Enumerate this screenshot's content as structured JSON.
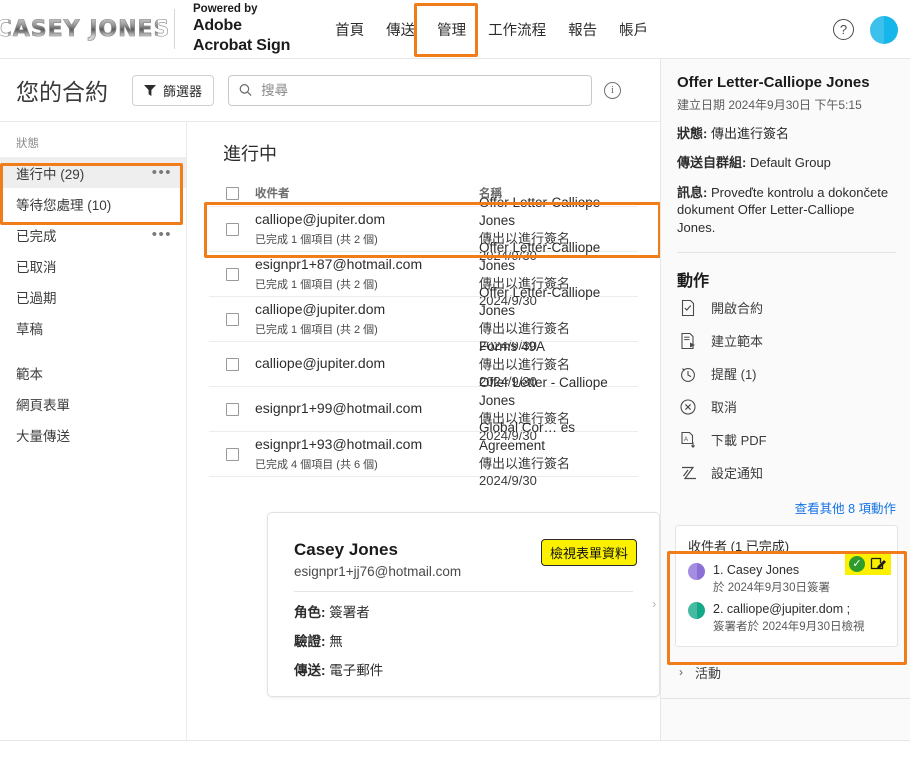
{
  "topbar": {
    "logo_text": "CASEY JONES",
    "powered_line1": "Powered by",
    "powered_line2": "Adobe",
    "powered_line3": "Acrobat Sign",
    "nav": [
      {
        "label": "首頁",
        "name": "nav-home"
      },
      {
        "label": "傳送",
        "name": "nav-send"
      },
      {
        "label": "管理",
        "name": "nav-manage"
      },
      {
        "label": "工作流程",
        "name": "nav-workflow"
      },
      {
        "label": "報告",
        "name": "nav-reports"
      },
      {
        "label": "帳戶",
        "name": "nav-account"
      }
    ],
    "help_glyph": "?",
    "highlight_color": "#f07d1a"
  },
  "titlebar": {
    "page_title": "您的合約",
    "filter_label": "篩選器",
    "search_placeholder": "搜尋",
    "search_value": "",
    "info_glyph": "i"
  },
  "sidebar": {
    "section_label": "狀態",
    "items": [
      {
        "label": "進行中 (29)",
        "name": "sidebar-item-in-progress",
        "selected": true,
        "dots": true
      },
      {
        "label": "等待您處理 (10)",
        "name": "sidebar-item-waiting-for-you",
        "selected": false,
        "dots": false
      },
      {
        "label": "已完成",
        "name": "sidebar-item-completed",
        "selected": false,
        "dots": true
      },
      {
        "label": "已取消",
        "name": "sidebar-item-cancelled",
        "selected": false,
        "dots": false
      },
      {
        "label": "已過期",
        "name": "sidebar-item-expired",
        "selected": false,
        "dots": false
      },
      {
        "label": "草稿",
        "name": "sidebar-item-draft",
        "selected": false,
        "dots": false
      }
    ],
    "items2": [
      {
        "label": "範本",
        "name": "sidebar-item-templates"
      },
      {
        "label": "網頁表單",
        "name": "sidebar-item-web-forms"
      },
      {
        "label": "大量傳送",
        "name": "sidebar-item-bulk-send"
      }
    ],
    "dots_glyph": "•••"
  },
  "main": {
    "heading": "進行中",
    "columns": {
      "recipient": "收件者",
      "name": "名稱"
    },
    "rows": [
      {
        "recipient": "calliope@jupiter.dom",
        "recipient_sub": "已完成 1 個項目 (共 2 個)",
        "name": "Offer Letter-Calliope Jones",
        "status": "傳出以進行簽名",
        "date": "2024/9/30",
        "highlighted": true
      },
      {
        "recipient": "esignpr1+87@hotmail.com",
        "recipient_sub": "已完成 1 個項目 (共 2 個)",
        "name": "Offer Letter-Calliope Jones",
        "status": "傳出以進行簽名",
        "date": "2024/9/30",
        "highlighted": false
      },
      {
        "recipient": "calliope@jupiter.dom",
        "recipient_sub": "已完成 1 個項目 (共 2 個)",
        "name": "Offer Letter-Calliope Jones",
        "status": "傳出以進行簽名",
        "date": "2024/9/30",
        "highlighted": false
      },
      {
        "recipient": "calliope@jupiter.dom",
        "recipient_sub": "",
        "name": "Forms 49A",
        "status": "傳出以進行簽名",
        "date": "2024/9/30",
        "highlighted": false
      },
      {
        "recipient": "esignpr1+99@hotmail.com",
        "recipient_sub": "",
        "name": "Offer Letter - Calliope Jones",
        "status": "傳出以進行簽名",
        "date": "2024/9/30",
        "highlighted": false
      },
      {
        "recipient": "esignpr1+93@hotmail.com",
        "recipient_sub": "已完成 4 個項目 (共 6 個)",
        "name": "Global Cor… es Agreement",
        "status": "傳出以進行簽名",
        "date": "2024/9/30",
        "highlighted": false
      }
    ]
  },
  "detail_card": {
    "name": "Casey Jones",
    "email": "esignpr1+jj76@hotmail.com",
    "form_data_button": "檢視表單資料",
    "role_label": "角色:",
    "role_value": "簽署者",
    "auth_label": "驗證:",
    "auth_value": "無",
    "delivery_label": "傳送:",
    "delivery_value": "電子郵件",
    "highlight_color": "#fbf000"
  },
  "right_panel": {
    "title": "Offer Letter-Calliope Jones",
    "created": "建立日期 2024年9月30日 下午5:15",
    "status_label": "狀態:",
    "status_value": "傳出進行簽名",
    "group_label": "傳送自群組:",
    "group_value": "Default Group",
    "message_label": "訊息:",
    "message_value": "Proveďte kontrolu a dokončete dokument Offer Letter-Calliope Jones.",
    "actions_title": "動作",
    "actions": [
      {
        "label": "開啟合約",
        "name": "action-open-agreement",
        "icon": "document-check-icon"
      },
      {
        "label": "建立範本",
        "name": "action-create-template",
        "icon": "template-icon"
      },
      {
        "label": "提醒 (1)",
        "name": "action-reminder",
        "icon": "clock-icon"
      },
      {
        "label": "取消",
        "name": "action-cancel",
        "icon": "cancel-circle-icon"
      },
      {
        "label": "下載 PDF",
        "name": "action-download-pdf",
        "icon": "download-pdf-icon"
      },
      {
        "label": "設定通知",
        "name": "action-set-notification",
        "icon": "notification-icon"
      }
    ],
    "more_actions": "查看其他 8 項動作",
    "recipients_title": "收件者 (1 已完成)",
    "recipients": [
      {
        "label": "1. Casey Jones",
        "sub": "於 2024年9月30日簽署",
        "avatar_color": "#8b6fd6",
        "name": "recipient-casey-jones"
      },
      {
        "label": "2. calliope@jupiter.dom ;",
        "sub": "簽署者於 2024年9月30日檢視",
        "avatar_color": "#13a888",
        "name": "recipient-calliope"
      }
    ],
    "status_check_glyph": "✓",
    "activity_label": "活動",
    "chevron_glyph": "›",
    "link_color": "#1473e6",
    "highlight_color": "#fbf000"
  }
}
